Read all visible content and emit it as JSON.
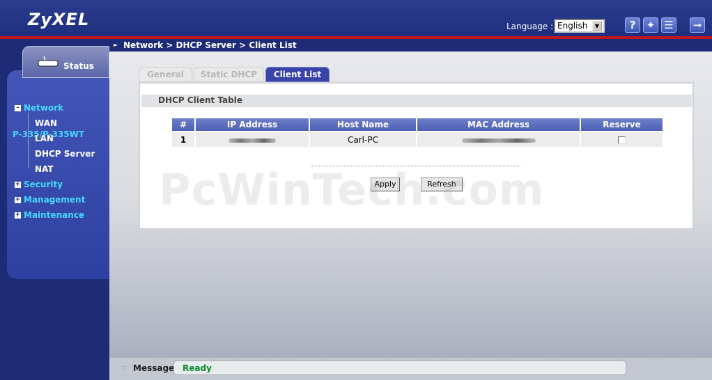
{
  "header": {
    "logo": "ZyXEL",
    "language_label": "Language :",
    "language_value": "English",
    "icons": [
      "help-icon",
      "wizard-icon",
      "about-icon",
      "logout-icon"
    ]
  },
  "sidebar": {
    "status_label": "Status",
    "device_name": "P-335/P-335WT",
    "network": "Network",
    "network_items": [
      "WAN",
      "LAN",
      "DHCP Server",
      "NAT"
    ],
    "security": "Security",
    "management": "Management",
    "maintenance": "Maintenance"
  },
  "breadcrumb": "Network > DHCP Server > Client List",
  "tabs": [
    {
      "label": "General",
      "active": false
    },
    {
      "label": "Static DHCP",
      "active": false
    },
    {
      "label": "Client List",
      "active": true
    }
  ],
  "section_title": "DHCP Client Table",
  "table": {
    "headers": [
      "#",
      "IP Address",
      "Host Name",
      "MAC Address",
      "Reserve"
    ],
    "rows": [
      {
        "index": "1",
        "ip": "",
        "host": "Carl-PC",
        "mac": "",
        "reserve": false
      }
    ]
  },
  "buttons": {
    "apply": "Apply",
    "refresh": "Refresh"
  },
  "watermark": "PcWinTech.com",
  "message": {
    "label": "Message",
    "text": "Ready"
  },
  "colors": {
    "nav_accent": "#45d8ff",
    "header_bg": "#2b3c8f",
    "red_line": "#c4161c",
    "ready_green": "#0a8a2c"
  }
}
